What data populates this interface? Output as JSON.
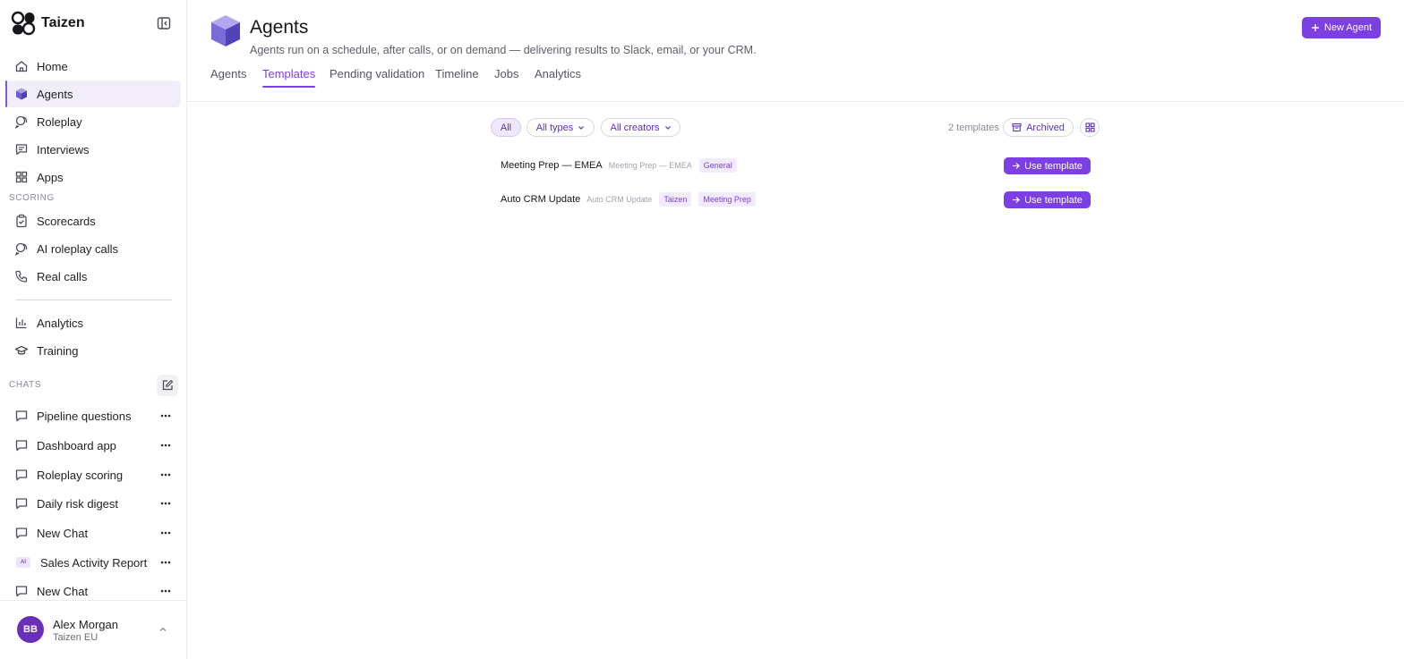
{
  "app": {
    "name": "Taizen"
  },
  "sidebar": {
    "nav": [
      {
        "label": "Home",
        "icon": "home-icon"
      },
      {
        "label": "Agents",
        "icon": "cube-icon",
        "active": true
      },
      {
        "label": "Roleplay",
        "icon": "roleplay-icon"
      },
      {
        "label": "Interviews",
        "icon": "message-square-icon"
      },
      {
        "label": "Apps",
        "icon": "apps-grid-icon"
      }
    ],
    "scoring_label": "SCORING",
    "scoring": [
      {
        "label": "Scorecards",
        "icon": "clipboard-check-icon"
      },
      {
        "label": "AI roleplay calls",
        "icon": "roleplay-icon"
      },
      {
        "label": "Real calls",
        "icon": "phone-icon"
      }
    ],
    "more": [
      {
        "label": "Analytics",
        "icon": "bar-chart-icon"
      },
      {
        "label": "Training",
        "icon": "graduation-cap-icon"
      }
    ],
    "chats_label": "CHATS",
    "chats": [
      {
        "label": "Pipeline questions",
        "icon": "chat-bubble-icon"
      },
      {
        "label": "Dashboard app",
        "icon": "chat-bubble-icon"
      },
      {
        "label": "Roleplay scoring",
        "icon": "chat-bubble-icon"
      },
      {
        "label": "Daily risk digest",
        "icon": "chat-bubble-icon"
      },
      {
        "label": "New Chat",
        "icon": "chat-bubble-icon"
      },
      {
        "label": "Sales Activity Report",
        "icon": "ai-badge-icon",
        "badge": "AI"
      },
      {
        "label": "New Chat",
        "icon": "chat-bubble-icon"
      }
    ]
  },
  "user": {
    "initials": "BB",
    "name": "Alex Morgan",
    "org": "Taizen EU"
  },
  "header": {
    "title": "Agents",
    "subtitle": "Agents run on a schedule, after calls, or on demand — delivering results to Slack, email, or your CRM.",
    "new_agent_label": "New Agent",
    "tabs": [
      "Agents",
      "Templates",
      "Pending validation",
      "Timeline",
      "Jobs",
      "Analytics"
    ],
    "active_tab": "Templates"
  },
  "filters": {
    "all_label": "All",
    "types_label": "All types",
    "creators_label": "All creators",
    "count_label": "2 templates",
    "archived_label": "Archived"
  },
  "templates": [
    {
      "name": "Meeting Prep — EMEA",
      "subtitle": "Meeting Prep — EMEA",
      "tags": [
        "General"
      ],
      "action": "Use template"
    },
    {
      "name": "Auto CRM Update",
      "subtitle": "Auto CRM Update",
      "tags": [
        "Taizen",
        "Meeting Prep"
      ],
      "action": "Use template"
    }
  ],
  "colors": {
    "accent": "#7b3fe4",
    "active_bg": "#f1eef9",
    "avatar": "#6a2fb8"
  }
}
